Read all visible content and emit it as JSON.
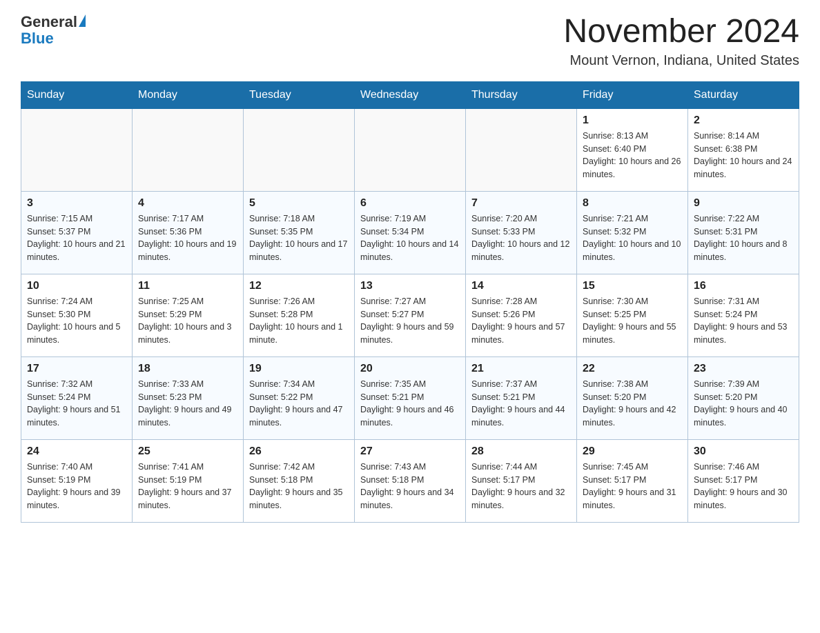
{
  "header": {
    "logo_text_general": "General",
    "logo_text_blue": "Blue",
    "month_title": "November 2024",
    "location": "Mount Vernon, Indiana, United States"
  },
  "days_of_week": [
    "Sunday",
    "Monday",
    "Tuesday",
    "Wednesday",
    "Thursday",
    "Friday",
    "Saturday"
  ],
  "weeks": [
    [
      {
        "day": "",
        "sunrise": "",
        "sunset": "",
        "daylight": ""
      },
      {
        "day": "",
        "sunrise": "",
        "sunset": "",
        "daylight": ""
      },
      {
        "day": "",
        "sunrise": "",
        "sunset": "",
        "daylight": ""
      },
      {
        "day": "",
        "sunrise": "",
        "sunset": "",
        "daylight": ""
      },
      {
        "day": "",
        "sunrise": "",
        "sunset": "",
        "daylight": ""
      },
      {
        "day": "1",
        "sunrise": "Sunrise: 8:13 AM",
        "sunset": "Sunset: 6:40 PM",
        "daylight": "Daylight: 10 hours and 26 minutes."
      },
      {
        "day": "2",
        "sunrise": "Sunrise: 8:14 AM",
        "sunset": "Sunset: 6:38 PM",
        "daylight": "Daylight: 10 hours and 24 minutes."
      }
    ],
    [
      {
        "day": "3",
        "sunrise": "Sunrise: 7:15 AM",
        "sunset": "Sunset: 5:37 PM",
        "daylight": "Daylight: 10 hours and 21 minutes."
      },
      {
        "day": "4",
        "sunrise": "Sunrise: 7:17 AM",
        "sunset": "Sunset: 5:36 PM",
        "daylight": "Daylight: 10 hours and 19 minutes."
      },
      {
        "day": "5",
        "sunrise": "Sunrise: 7:18 AM",
        "sunset": "Sunset: 5:35 PM",
        "daylight": "Daylight: 10 hours and 17 minutes."
      },
      {
        "day": "6",
        "sunrise": "Sunrise: 7:19 AM",
        "sunset": "Sunset: 5:34 PM",
        "daylight": "Daylight: 10 hours and 14 minutes."
      },
      {
        "day": "7",
        "sunrise": "Sunrise: 7:20 AM",
        "sunset": "Sunset: 5:33 PM",
        "daylight": "Daylight: 10 hours and 12 minutes."
      },
      {
        "day": "8",
        "sunrise": "Sunrise: 7:21 AM",
        "sunset": "Sunset: 5:32 PM",
        "daylight": "Daylight: 10 hours and 10 minutes."
      },
      {
        "day": "9",
        "sunrise": "Sunrise: 7:22 AM",
        "sunset": "Sunset: 5:31 PM",
        "daylight": "Daylight: 10 hours and 8 minutes."
      }
    ],
    [
      {
        "day": "10",
        "sunrise": "Sunrise: 7:24 AM",
        "sunset": "Sunset: 5:30 PM",
        "daylight": "Daylight: 10 hours and 5 minutes."
      },
      {
        "day": "11",
        "sunrise": "Sunrise: 7:25 AM",
        "sunset": "Sunset: 5:29 PM",
        "daylight": "Daylight: 10 hours and 3 minutes."
      },
      {
        "day": "12",
        "sunrise": "Sunrise: 7:26 AM",
        "sunset": "Sunset: 5:28 PM",
        "daylight": "Daylight: 10 hours and 1 minute."
      },
      {
        "day": "13",
        "sunrise": "Sunrise: 7:27 AM",
        "sunset": "Sunset: 5:27 PM",
        "daylight": "Daylight: 9 hours and 59 minutes."
      },
      {
        "day": "14",
        "sunrise": "Sunrise: 7:28 AM",
        "sunset": "Sunset: 5:26 PM",
        "daylight": "Daylight: 9 hours and 57 minutes."
      },
      {
        "day": "15",
        "sunrise": "Sunrise: 7:30 AM",
        "sunset": "Sunset: 5:25 PM",
        "daylight": "Daylight: 9 hours and 55 minutes."
      },
      {
        "day": "16",
        "sunrise": "Sunrise: 7:31 AM",
        "sunset": "Sunset: 5:24 PM",
        "daylight": "Daylight: 9 hours and 53 minutes."
      }
    ],
    [
      {
        "day": "17",
        "sunrise": "Sunrise: 7:32 AM",
        "sunset": "Sunset: 5:24 PM",
        "daylight": "Daylight: 9 hours and 51 minutes."
      },
      {
        "day": "18",
        "sunrise": "Sunrise: 7:33 AM",
        "sunset": "Sunset: 5:23 PM",
        "daylight": "Daylight: 9 hours and 49 minutes."
      },
      {
        "day": "19",
        "sunrise": "Sunrise: 7:34 AM",
        "sunset": "Sunset: 5:22 PM",
        "daylight": "Daylight: 9 hours and 47 minutes."
      },
      {
        "day": "20",
        "sunrise": "Sunrise: 7:35 AM",
        "sunset": "Sunset: 5:21 PM",
        "daylight": "Daylight: 9 hours and 46 minutes."
      },
      {
        "day": "21",
        "sunrise": "Sunrise: 7:37 AM",
        "sunset": "Sunset: 5:21 PM",
        "daylight": "Daylight: 9 hours and 44 minutes."
      },
      {
        "day": "22",
        "sunrise": "Sunrise: 7:38 AM",
        "sunset": "Sunset: 5:20 PM",
        "daylight": "Daylight: 9 hours and 42 minutes."
      },
      {
        "day": "23",
        "sunrise": "Sunrise: 7:39 AM",
        "sunset": "Sunset: 5:20 PM",
        "daylight": "Daylight: 9 hours and 40 minutes."
      }
    ],
    [
      {
        "day": "24",
        "sunrise": "Sunrise: 7:40 AM",
        "sunset": "Sunset: 5:19 PM",
        "daylight": "Daylight: 9 hours and 39 minutes."
      },
      {
        "day": "25",
        "sunrise": "Sunrise: 7:41 AM",
        "sunset": "Sunset: 5:19 PM",
        "daylight": "Daylight: 9 hours and 37 minutes."
      },
      {
        "day": "26",
        "sunrise": "Sunrise: 7:42 AM",
        "sunset": "Sunset: 5:18 PM",
        "daylight": "Daylight: 9 hours and 35 minutes."
      },
      {
        "day": "27",
        "sunrise": "Sunrise: 7:43 AM",
        "sunset": "Sunset: 5:18 PM",
        "daylight": "Daylight: 9 hours and 34 minutes."
      },
      {
        "day": "28",
        "sunrise": "Sunrise: 7:44 AM",
        "sunset": "Sunset: 5:17 PM",
        "daylight": "Daylight: 9 hours and 32 minutes."
      },
      {
        "day": "29",
        "sunrise": "Sunrise: 7:45 AM",
        "sunset": "Sunset: 5:17 PM",
        "daylight": "Daylight: 9 hours and 31 minutes."
      },
      {
        "day": "30",
        "sunrise": "Sunrise: 7:46 AM",
        "sunset": "Sunset: 5:17 PM",
        "daylight": "Daylight: 9 hours and 30 minutes."
      }
    ]
  ]
}
